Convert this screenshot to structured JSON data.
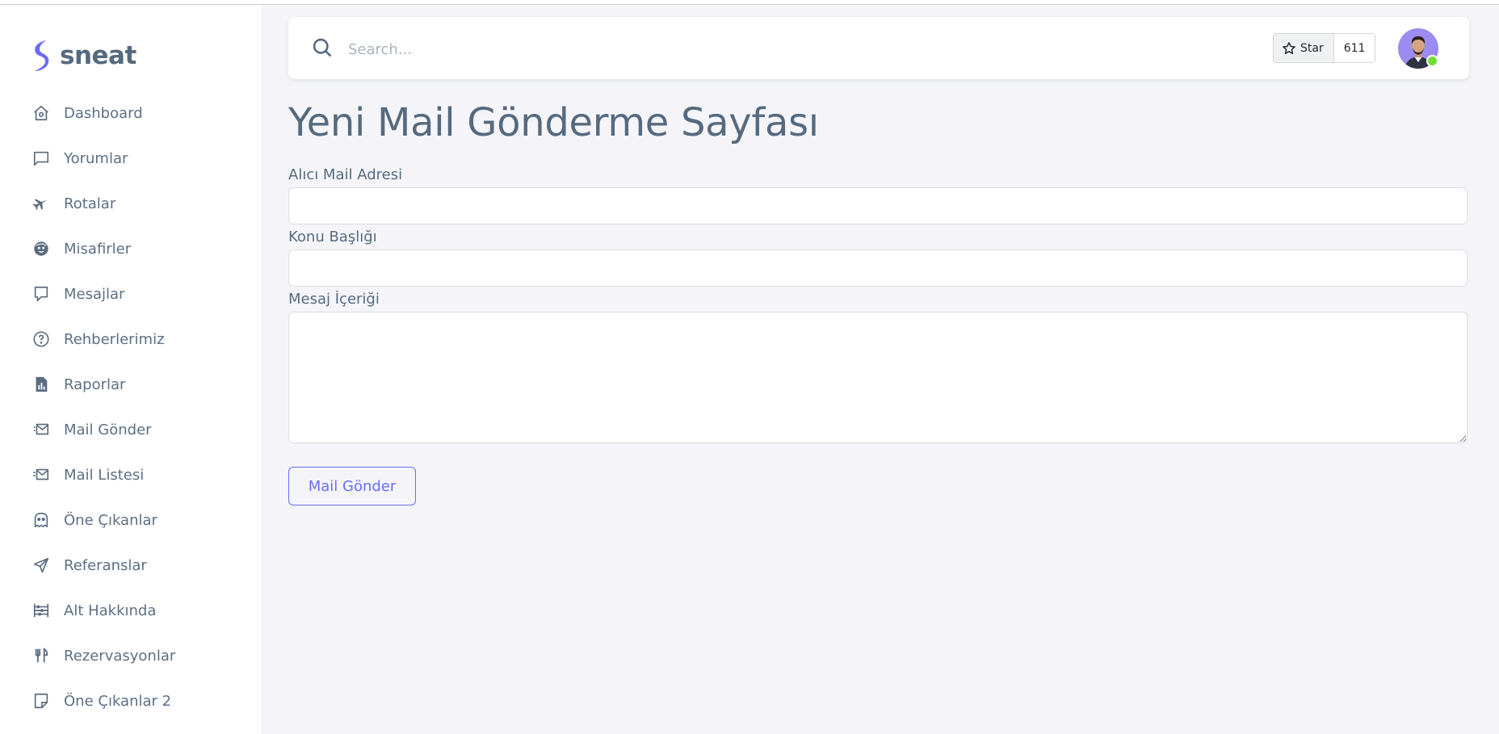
{
  "brand": {
    "name": "sneat",
    "logo_color": "#696cff"
  },
  "sidebar": {
    "items": [
      {
        "label": "Dashboard",
        "icon": "home-icon"
      },
      {
        "label": "Yorumlar",
        "icon": "message-square-icon"
      },
      {
        "label": "Rotalar",
        "icon": "plane-icon"
      },
      {
        "label": "Misafirler",
        "icon": "face-icon"
      },
      {
        "label": "Mesajlar",
        "icon": "chat-icon"
      },
      {
        "label": "Rehberlerimiz",
        "icon": "help-circle-icon"
      },
      {
        "label": "Raporlar",
        "icon": "report-file-icon"
      },
      {
        "label": "Mail Gönder",
        "icon": "mail-send-icon"
      },
      {
        "label": "Mail Listesi",
        "icon": "mail-list-icon"
      },
      {
        "label": "Öne Çıkanlar",
        "icon": "ghost-icon"
      },
      {
        "label": "Referanslar",
        "icon": "navigation-icon"
      },
      {
        "label": "Alt Hakkında",
        "icon": "abacus-icon"
      },
      {
        "label": "Rezervasyonlar",
        "icon": "restaurant-icon"
      },
      {
        "label": "Öne Çıkanlar 2",
        "icon": "note-icon"
      }
    ]
  },
  "navbar": {
    "search": {
      "placeholder": "Search...",
      "value": ""
    },
    "github": {
      "star_label": "Star",
      "count": "611"
    },
    "avatar": {
      "status_color": "#71dd37"
    }
  },
  "main": {
    "title": "Yeni Mail Gönderme Sayfası",
    "form": {
      "recipient_label": "Alıcı Mail Adresi",
      "recipient_value": "",
      "subject_label": "Konu Başlığı",
      "subject_value": "",
      "message_label": "Mesaj İçeriği",
      "message_value": "",
      "submit_label": "Mail Gönder"
    }
  },
  "colors": {
    "primary": "#696cff",
    "text": "#566a7f",
    "background": "#f5f5f9"
  }
}
